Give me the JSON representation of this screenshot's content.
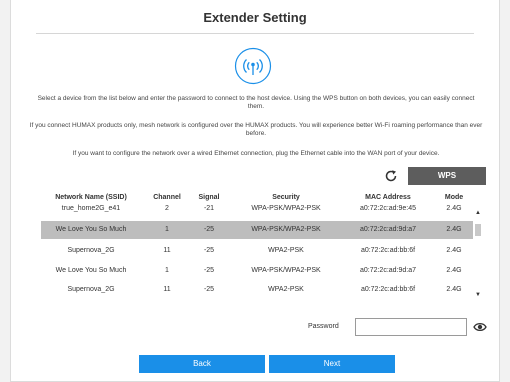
{
  "page": {
    "title": "Extender Setting"
  },
  "info": {
    "line1": "Select a device from the list below and enter the password to connect to the host device. Using the WPS button on both devices, you can easily connect them.",
    "line2": "If you connect HUMAX products only, mesh network is configured over the HUMAX products. You will experience better Wi-Fi roaming performance than ever before.",
    "line3": "If you want to configure the network over a wired Ethernet connection, plug the Ethernet cable into the WAN port of your device."
  },
  "toolbar": {
    "wps_label": "WPS",
    "refresh_icon": "refresh-icon"
  },
  "table": {
    "headers": {
      "ssid": "Network Name (SSID)",
      "channel": "Channel",
      "signal": "Signal",
      "security": "Security",
      "mac": "MAC Address",
      "mode": "Mode"
    },
    "rows": [
      {
        "ssid": "true_home2G_e41",
        "channel": "2",
        "signal": "-21",
        "security": "WPA-PSK/WPA2-PSK",
        "mac": "a0:72:2c:ad:9e:45",
        "mode": "2.4G"
      },
      {
        "ssid": "We Love You So Much",
        "channel": "1",
        "signal": "-25",
        "security": "WPA-PSK/WPA2-PSK",
        "mac": "a0:72:2c:ad:9d:a7",
        "mode": "2.4G"
      },
      {
        "ssid": "Supernova_2G",
        "channel": "11",
        "signal": "-25",
        "security": "WPA2-PSK",
        "mac": "a0:72:2c:ad:bb:6f",
        "mode": "2.4G"
      },
      {
        "ssid": "We Love You So Much",
        "channel": "1",
        "signal": "-25",
        "security": "WPA-PSK/WPA2-PSK",
        "mac": "a0:72:2c:ad:9d:a7",
        "mode": "2.4G"
      },
      {
        "ssid": "Supernova_2G",
        "channel": "11",
        "signal": "-25",
        "security": "WPA2-PSK",
        "mac": "a0:72:2c:ad:bb:6f",
        "mode": "2.4G"
      }
    ],
    "selected_row": 1
  },
  "password": {
    "label": "Password",
    "value": "",
    "placeholder": ""
  },
  "buttons": {
    "back_label": "Back",
    "next_label": "Next"
  },
  "colors": {
    "primary": "#1a8fe8",
    "wps": "#5d5d5d",
    "selected_row": "#bdbdbd"
  }
}
